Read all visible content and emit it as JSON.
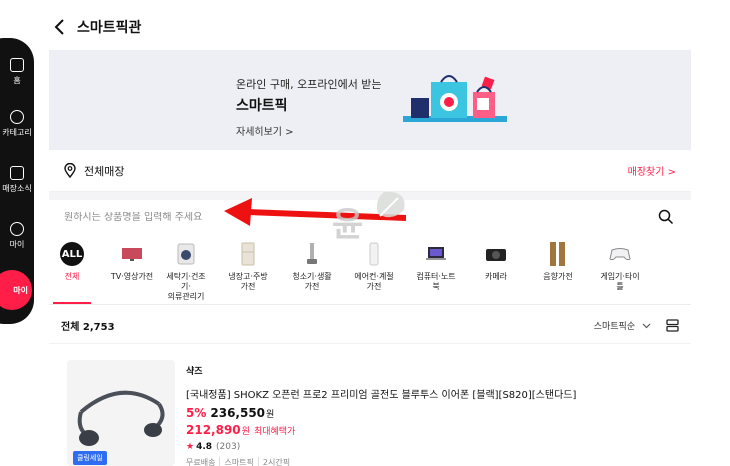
{
  "header": {
    "title": "스마트픽관"
  },
  "rail": {
    "items": [
      "홈",
      "카테고리",
      "매장소식",
      "마이"
    ],
    "button": "마이"
  },
  "banner": {
    "subtitle": "온라인 구매, 오프라인에서 받는",
    "title": "스마트픽",
    "link": "자세히보기 >"
  },
  "store": {
    "label": "전체매장",
    "find": "매장찾기 >"
  },
  "search": {
    "placeholder": "원하시는 상품명을 입력해 주세요"
  },
  "categories": [
    {
      "label": "전체",
      "icon": "ALL",
      "active": true
    },
    {
      "label": "TV·영상가전",
      "icon": "tv-icon"
    },
    {
      "label": "세탁기·건조기·\n의류관리기",
      "icon": "washer-icon"
    },
    {
      "label": "냉장고·주방가전",
      "icon": "fridge-icon"
    },
    {
      "label": "청소기·생활가전",
      "icon": "vacuum-icon"
    },
    {
      "label": "에어컨·계절가전",
      "icon": "aircon-icon"
    },
    {
      "label": "컴퓨터·노트북",
      "icon": "laptop-icon"
    },
    {
      "label": "카메라",
      "icon": "camera-icon"
    },
    {
      "label": "음향가전",
      "icon": "speaker-icon"
    },
    {
      "label": "게임기·타이틀",
      "icon": "gamepad-icon"
    }
  ],
  "list": {
    "count_label": "전체",
    "count": "2,753",
    "sort": "스마트픽순"
  },
  "product": {
    "badge": "쿨링세일",
    "brand": "샥즈",
    "name": "[국내정품] SHOKZ 오픈런 프로2 프리미엄 골전도 블루투스 이어폰 [블랙][S820][스탠다드]",
    "discount": "5%",
    "price": "236,550",
    "price_unit": "원",
    "benefit_price": "212,890",
    "benefit_unit": "원",
    "benefit_label": "최대혜택가",
    "rating": "4.8",
    "reviews": "(203)",
    "tags": [
      "무료배송",
      "스마트픽",
      "2시간픽"
    ]
  },
  "colors": {
    "accent": "#ff1e48",
    "badge": "#2f6df0",
    "banner_bg": "#eeeff4"
  }
}
